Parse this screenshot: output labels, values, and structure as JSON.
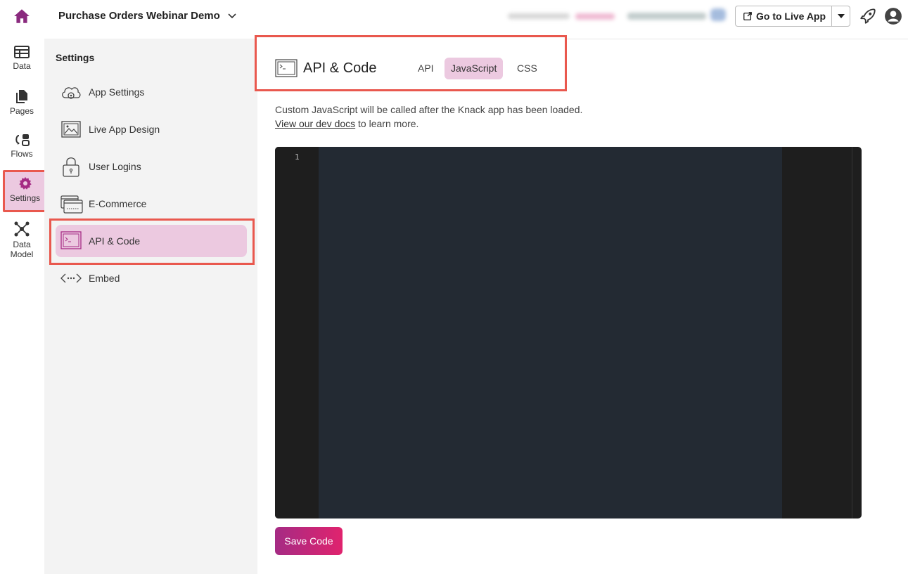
{
  "topbar": {
    "app_title": "Purchase Orders Webinar Demo",
    "live_app_label": "Go to Live App"
  },
  "rail": {
    "items": [
      {
        "label": "Data",
        "icon": "table-icon"
      },
      {
        "label": "Pages",
        "icon": "pages-icon"
      },
      {
        "label": "Flows",
        "icon": "flows-icon"
      },
      {
        "label": "Settings",
        "icon": "gear-icon"
      },
      {
        "label_line1": "Data",
        "label_line2": "Model",
        "icon": "data-model-icon"
      }
    ]
  },
  "settings": {
    "heading": "Settings",
    "items": [
      {
        "label": "App Settings",
        "icon": "cloud-gear-icon"
      },
      {
        "label": "Live App Design",
        "icon": "image-icon"
      },
      {
        "label": "User Logins",
        "icon": "lock-icon"
      },
      {
        "label": "E-Commerce",
        "icon": "credit-card-icon"
      },
      {
        "label": "API & Code",
        "icon": "terminal-icon"
      },
      {
        "label": "Embed",
        "icon": "embed-icon"
      }
    ],
    "active_item": "API & Code"
  },
  "main": {
    "title": "API & Code",
    "tabs": [
      {
        "label": "API"
      },
      {
        "label": "JavaScript"
      },
      {
        "label": "CSS"
      }
    ],
    "active_tab": "JavaScript",
    "description_line1": "Custom JavaScript will be called after the Knack app has been loaded.",
    "docs_link": "View our dev docs",
    "description_line2_rest": " to learn more.",
    "editor": {
      "line_number": "1"
    },
    "save_label": "Save Code"
  },
  "colors": {
    "accent": "#a52b84",
    "active_bg": "#ecc9e0",
    "highlight_frame": "#e9584e",
    "editor_bg": "#232a33"
  }
}
